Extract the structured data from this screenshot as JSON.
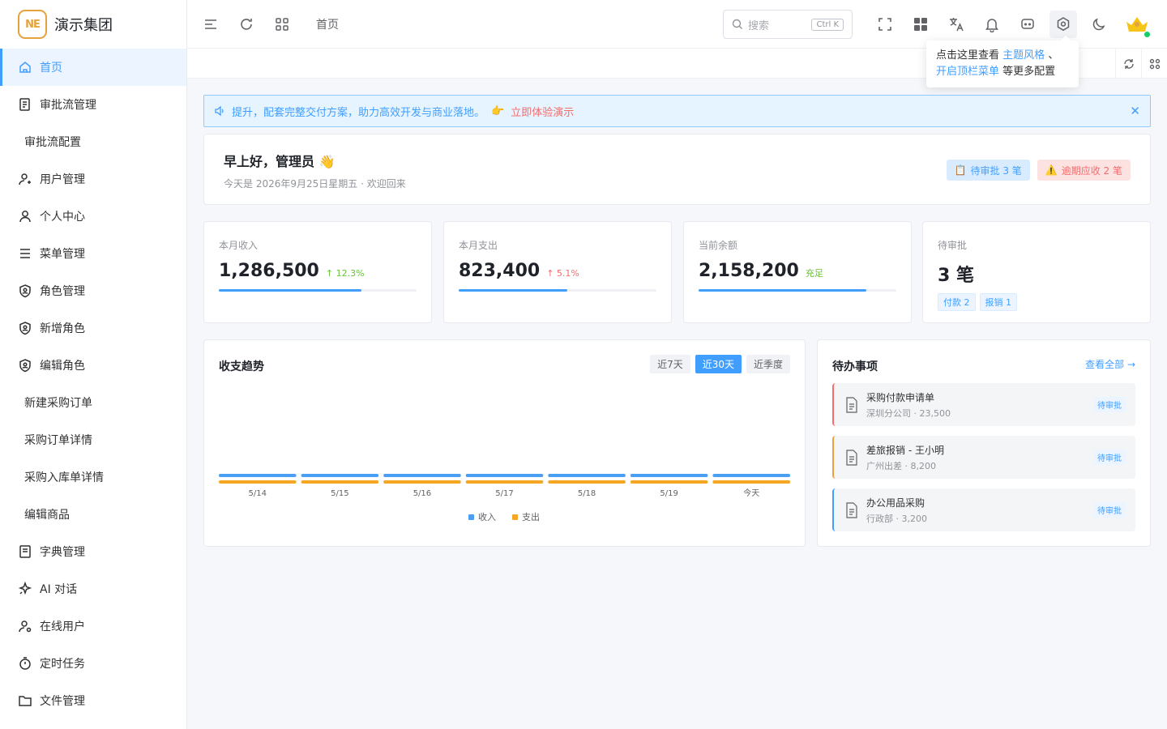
{
  "brand": {
    "logo_text": "NE",
    "name": "演示集团"
  },
  "sidebar": {
    "items": [
      {
        "label": "首页",
        "icon": "home-icon",
        "level": 1,
        "active": true
      },
      {
        "label": "审批流管理",
        "icon": "document-icon",
        "level": 1
      },
      {
        "label": "审批流配置",
        "level": 2
      },
      {
        "label": "用户管理",
        "icon": "user-settings-icon",
        "level": 1
      },
      {
        "label": "个人中心",
        "icon": "user-icon",
        "level": 1
      },
      {
        "label": "菜单管理",
        "icon": "menu-icon",
        "level": 1
      },
      {
        "label": "角色管理",
        "icon": "shield-user-icon",
        "level": 1
      },
      {
        "label": "新增角色",
        "icon": "shield-user-icon",
        "level": 1
      },
      {
        "label": "编辑角色",
        "icon": "shield-user-icon",
        "level": 1
      },
      {
        "label": "新建采购订单",
        "level": 2
      },
      {
        "label": "采购订单详情",
        "level": 2
      },
      {
        "label": "采购入库单详情",
        "level": 2
      },
      {
        "label": "编辑商品",
        "level": 2
      },
      {
        "label": "字典管理",
        "icon": "book-icon",
        "level": 1
      },
      {
        "label": "AI 对话",
        "icon": "sparkle-icon",
        "level": 1
      },
      {
        "label": "在线用户",
        "icon": "user-online-icon",
        "level": 1
      },
      {
        "label": "定时任务",
        "icon": "timer-icon",
        "level": 1
      },
      {
        "label": "文件管理",
        "icon": "folder-icon",
        "level": 1
      }
    ]
  },
  "topbar": {
    "breadcrumb": "首页",
    "search_placeholder": "搜索",
    "search_shortcut": "Ctrl K"
  },
  "tooltip": {
    "line1_prefix": "点击这里查看",
    "link1": "主题风格",
    "sep": "、",
    "link2": "开启顶栏菜单",
    "suffix": "等更多配置"
  },
  "notice": {
    "text": "提升，配套完整交付方案，助力高效开发与商业落地。",
    "cta": "立即体验演示",
    "close": "✕"
  },
  "greeting": {
    "title": "早上好，管理员 👋",
    "subtitle": "今天是 2026年9月25日星期五 · 欢迎回来",
    "badge_pending": "待审批 3 笔",
    "badge_overdue": "逾期应收 2 笔"
  },
  "stats": [
    {
      "label": "本月收入",
      "value": "1,286,500",
      "change": "↑ 12.3%",
      "trend": "up",
      "progress": 0.72
    },
    {
      "label": "本月支出",
      "value": "823,400",
      "change": "↑ 5.1%",
      "trend": "down",
      "progress": 0.55
    },
    {
      "label": "当前余额",
      "value": "2,158,200",
      "change": "充足",
      "trend": "up",
      "progress": 0.85
    },
    {
      "label": "待审批",
      "value": "3 笔",
      "tags": [
        "付款 2",
        "报销 1"
      ]
    }
  ],
  "chart": {
    "title": "收支趋势",
    "ranges": [
      "近7天",
      "近30天",
      "近季度"
    ],
    "active_range": "近30天",
    "colors": {
      "income": "#4a9ff5",
      "expense": "#f5a623"
    }
  },
  "chart_data": {
    "type": "bar",
    "categories": [
      "5/14",
      "5/15",
      "5/16",
      "5/17",
      "5/18",
      "5/19",
      "今天"
    ],
    "series": [
      {
        "name": "收入",
        "values": [
          0,
          0,
          0,
          0,
          0,
          0,
          0
        ]
      },
      {
        "name": "支出",
        "values": [
          0,
          0,
          0,
          0,
          0,
          0,
          0
        ]
      }
    ],
    "legend": "bottom-center"
  },
  "todo": {
    "title": "待办事项",
    "more": "查看全部 →",
    "items": [
      {
        "title": "采购付款申请单",
        "sub": "深圳分公司 · 23,500",
        "status": "待审批",
        "accent": "#f56c6c"
      },
      {
        "title": "差旅报销 - 王小明",
        "sub": "广州出差 · 8,200",
        "status": "待审批",
        "accent": "#e6a23c"
      },
      {
        "title": "办公用品采购",
        "sub": "行政部 · 3,200",
        "status": "待审批",
        "accent": "#409eff"
      }
    ]
  }
}
